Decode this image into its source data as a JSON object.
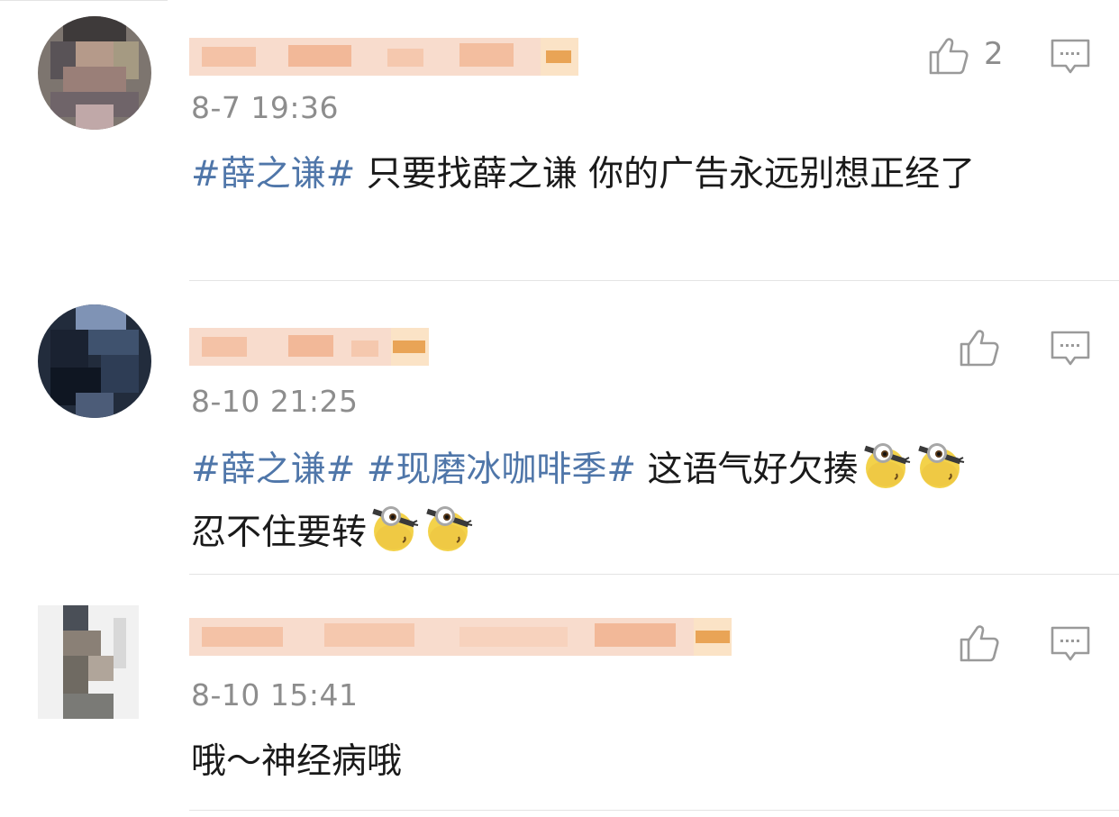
{
  "comments": [
    {
      "time": "8-7 19:36",
      "like_count": "2",
      "segments": [
        {
          "text": "#薛之谦#",
          "topic": true
        },
        {
          "text": "  只要找薛之谦 你的广告永远别想正经了",
          "topic": false
        }
      ]
    },
    {
      "time": "8-10 21:25",
      "like_count": "",
      "segments": [
        {
          "text": "#薛之谦# #现磨冰咖啡季#",
          "topic": true
        },
        {
          "text": " 这语气好欠揍",
          "topic": false
        },
        {
          "emoji": "minion-emoji"
        },
        {
          "emoji": "minion-emoji"
        },
        {
          "text": "忍不住要转",
          "topic": false
        },
        {
          "emoji": "minion-emoji"
        },
        {
          "emoji": "minion-emoji"
        }
      ]
    },
    {
      "time": "8-10 15:41",
      "like_count": "",
      "segments": [
        {
          "text": "哦～神经病哦",
          "topic": false
        }
      ]
    }
  ],
  "icons": {
    "like": "thumbs-up-icon",
    "reply": "comment-bubble-icon",
    "emoji": "minion-emoji"
  },
  "colors": {
    "topic": "#4f76a9",
    "meta": "#8d8d8d",
    "text": "#1a1a1a",
    "icon": "#9a9a9a"
  }
}
